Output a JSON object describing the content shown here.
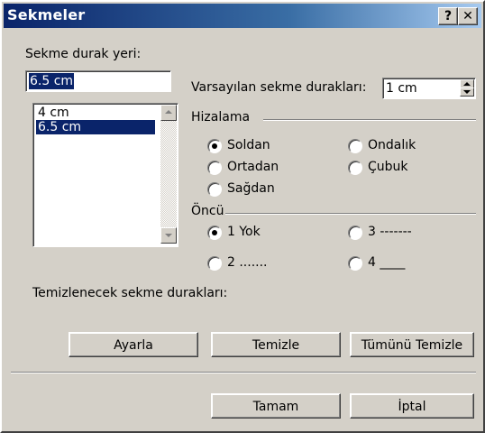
{
  "window": {
    "title": "Sekmeler",
    "help_button": "?",
    "close_button": "✕"
  },
  "tab_stop": {
    "label": "Sekme durak yeri:",
    "value": "6.5 cm",
    "list": [
      "4 cm",
      "6.5 cm"
    ]
  },
  "default_tabs": {
    "label": "Varsayılan sekme durakları:",
    "value": "1 cm"
  },
  "alignment": {
    "title": "Hizalama",
    "options": [
      "Soldan",
      "Ortadan",
      "Sağdan",
      "Ondalık",
      "Çubuk"
    ],
    "selected": "Soldan"
  },
  "leader": {
    "title": "Öncü",
    "options": [
      "1 Yok",
      "2 .......",
      "3 -------",
      "4 ____"
    ],
    "selected": "1 Yok"
  },
  "clear_label": "Temizlenecek sekme durakları:",
  "buttons": {
    "set": "Ayarla",
    "clear": "Temizle",
    "clear_all": "Tümünü Temizle",
    "ok": "Tamam",
    "cancel": "İptal"
  }
}
